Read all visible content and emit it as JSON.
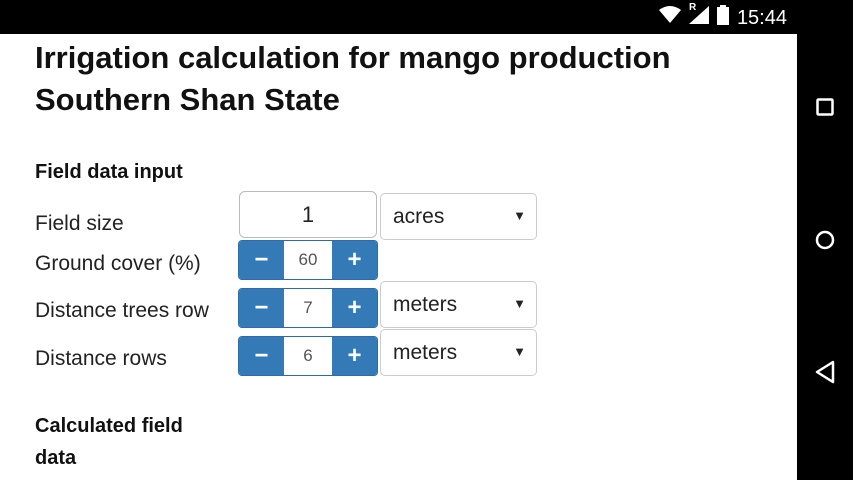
{
  "status_bar": {
    "time": "15:44",
    "icons": [
      "wifi-icon",
      "signal-icon",
      "battery-icon"
    ],
    "roaming_label": "R"
  },
  "page": {
    "title_line1": "Irrigation calculation for mango production",
    "title_line2": "Southern Shan State"
  },
  "field_input": {
    "section_title": "Field data input",
    "field_size": {
      "label": "Field size",
      "value": "1",
      "unit": "acres"
    },
    "ground_cover": {
      "label": "Ground cover (%)",
      "value": "60",
      "minus": "−",
      "plus": "+"
    },
    "distance_trees_row": {
      "label": "Distance trees row",
      "value": "7",
      "unit": "meters",
      "minus": "−",
      "plus": "+"
    },
    "distance_rows": {
      "label": "Distance rows",
      "value": "6",
      "unit": "meters",
      "minus": "−",
      "plus": "+"
    }
  },
  "calculated": {
    "title_line1": "Calculated field",
    "title_line2": "data"
  },
  "colors": {
    "accent": "#337ab7",
    "background": "#ffffff",
    "system_bar": "#000000"
  }
}
